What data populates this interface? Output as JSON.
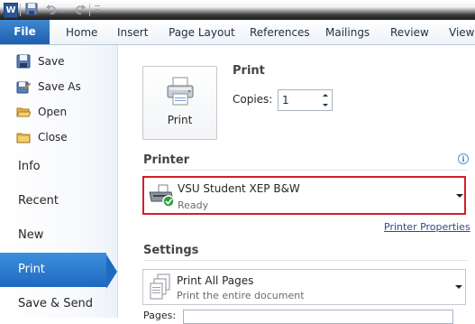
{
  "app": {
    "logo_letter": "W"
  },
  "ribbon": {
    "file_label": "File",
    "tabs": [
      {
        "label": "Home"
      },
      {
        "label": "Insert"
      },
      {
        "label": "Page Layout"
      },
      {
        "label": "References"
      },
      {
        "label": "Mailings"
      },
      {
        "label": "Review"
      },
      {
        "label": "View"
      }
    ]
  },
  "nav": {
    "small_items": [
      {
        "label": "Save",
        "icon": "save-icon"
      },
      {
        "label": "Save As",
        "icon": "save-as-icon"
      },
      {
        "label": "Open",
        "icon": "open-folder-icon"
      },
      {
        "label": "Close",
        "icon": "close-folder-icon"
      }
    ],
    "big_items": [
      {
        "label": "Info",
        "active": false
      },
      {
        "label": "Recent",
        "active": false
      },
      {
        "label": "New",
        "active": false
      },
      {
        "label": "Print",
        "active": true
      },
      {
        "label": "Save & Send",
        "active": false
      }
    ]
  },
  "print": {
    "button_label": "Print",
    "heading": "Print",
    "copies_label": "Copies:",
    "copies_value": "1"
  },
  "printer": {
    "heading": "Printer",
    "name": "VSU Student XEP B&W",
    "status": "Ready",
    "properties_link": "Printer Properties",
    "info_icon": "info-icon",
    "highlight_color": "#d21f2b"
  },
  "settings": {
    "heading": "Settings",
    "pages_option_title": "Print All Pages",
    "pages_option_desc": "Print the entire document",
    "pages_label": "Pages:"
  },
  "colors": {
    "accent": "#1e68c0",
    "file_tab": "#2b6fc0"
  }
}
